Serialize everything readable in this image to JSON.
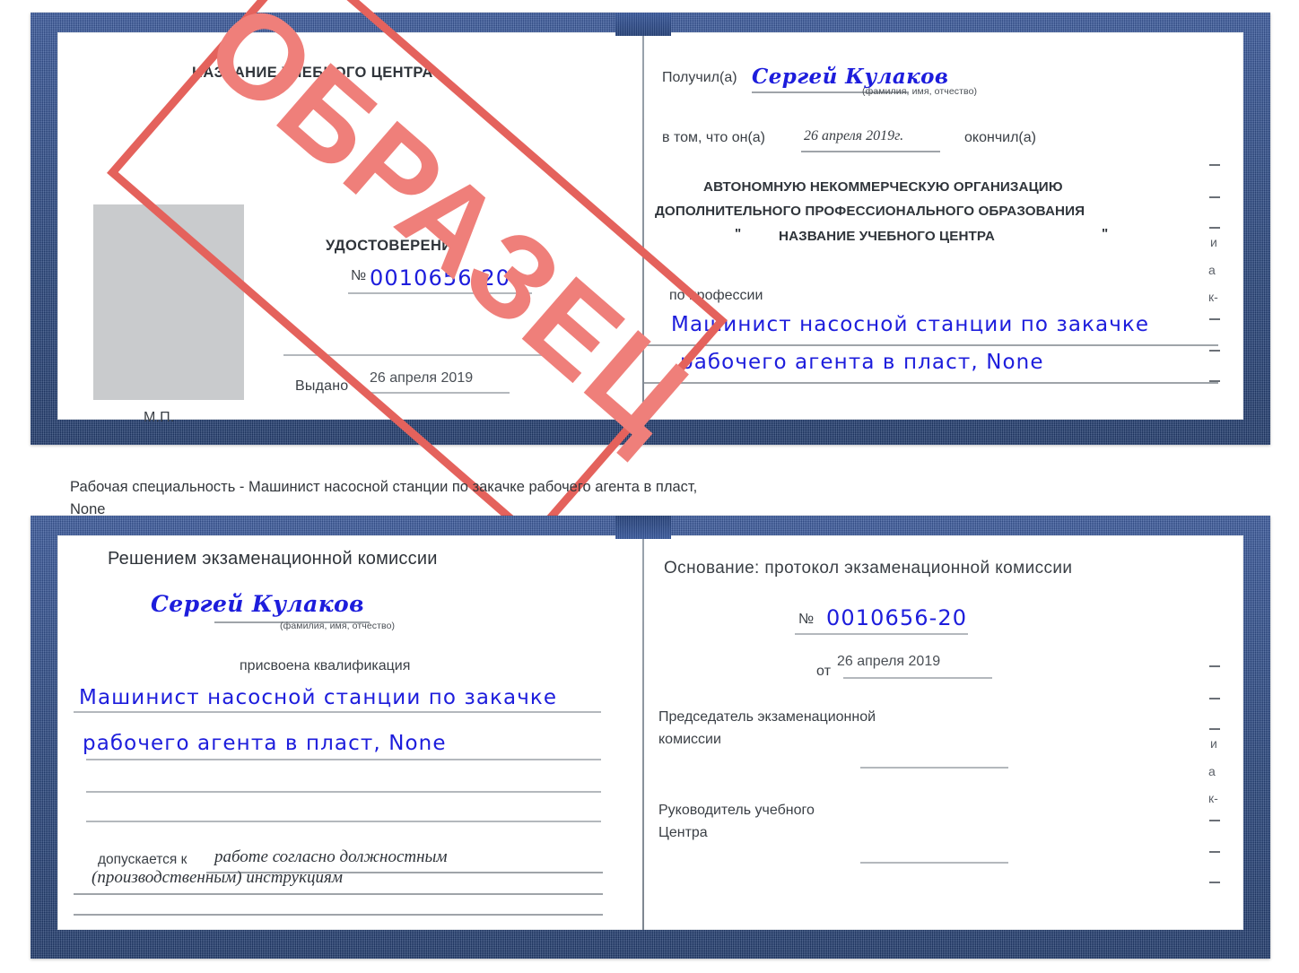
{
  "meta": {
    "watermark_text": "ОБРАЗЕЦ",
    "accent_blue": "#2d4c8d",
    "handwriting_blue": "#1d1ddc",
    "watermark_red": "#e4625c",
    "photo_placeholder_color": "#c9cbcd"
  },
  "caption": {
    "line1": "Рабочая специальность - Машинист насосной станции по закачке рабочего агента в пласт,",
    "line2": "None"
  },
  "certificate_top": {
    "left_page": {
      "header": "НАЗВАНИЕ УЧЕБНОГО ЦЕНТРА",
      "doc_type": "УДОСТОВЕРЕНИЕ",
      "number_label": "№",
      "number_value": "0010656-20",
      "issued_label": "Выдано",
      "issued_value": "26 апреля 2019",
      "stamp_label": "М.П."
    },
    "right_page": {
      "received_label": "Получил(а)",
      "received_value": "Сергей Кулаков",
      "name_hint": "(фамилия, имя, отчество)",
      "that_he_label": "в том, что он(а)",
      "completion_date": "26 апреля 2019г.",
      "finished_label": "окончил(а)",
      "org_line1": "АВТОНОМНУЮ НЕКОММЕРЧЕСКУЮ ОРГАНИЗАЦИЮ",
      "org_line2": "ДОПОЛНИТЕЛЬНОГО ПРОФЕССИОНАЛЬНОГО ОБРАЗОВАНИЯ",
      "org_quote_open": "\"",
      "org_line3": "НАЗВАНИЕ УЧЕБНОГО ЦЕНТРА",
      "org_quote_close": "\"",
      "profession_label": "по профессии",
      "profession_line1": "Машинист насосной станции по закачке",
      "profession_line2": "рабочего агента в пласт, None"
    }
  },
  "certificate_bottom": {
    "left_page": {
      "header": "Решением экзаменационной комиссии",
      "name_value": "Сергей Кулаков",
      "name_hint": "(фамилия, имя, отчество)",
      "qualification_label": "присвоена квалификация",
      "qualification_line1": "Машинист насосной станции по закачке",
      "qualification_line2": "рабочего агента в пласт, None",
      "admitted_label": "допускается к",
      "admitted_line1": "работе согласно должностным",
      "admitted_line2": "(производственным) инструкциям"
    },
    "right_page": {
      "basis_label": "Основание: протокол экзаменационной комиссии",
      "number_label": "№",
      "number_value": "0010656-20",
      "date_label": "от",
      "date_value": "26 апреля 2019",
      "chairman_line1": "Председатель экзаменационной",
      "chairman_line2": "комиссии",
      "head_line1": "Руководитель учебного",
      "head_line2": "Центра"
    }
  },
  "edge_fragments": {
    "top": [
      "–",
      "–",
      "–",
      "и",
      "а",
      "к-",
      "–",
      "–",
      "–"
    ],
    "bottom": [
      "–",
      "–",
      "–",
      "и",
      "а",
      "к-",
      "–",
      "–",
      "–"
    ]
  }
}
